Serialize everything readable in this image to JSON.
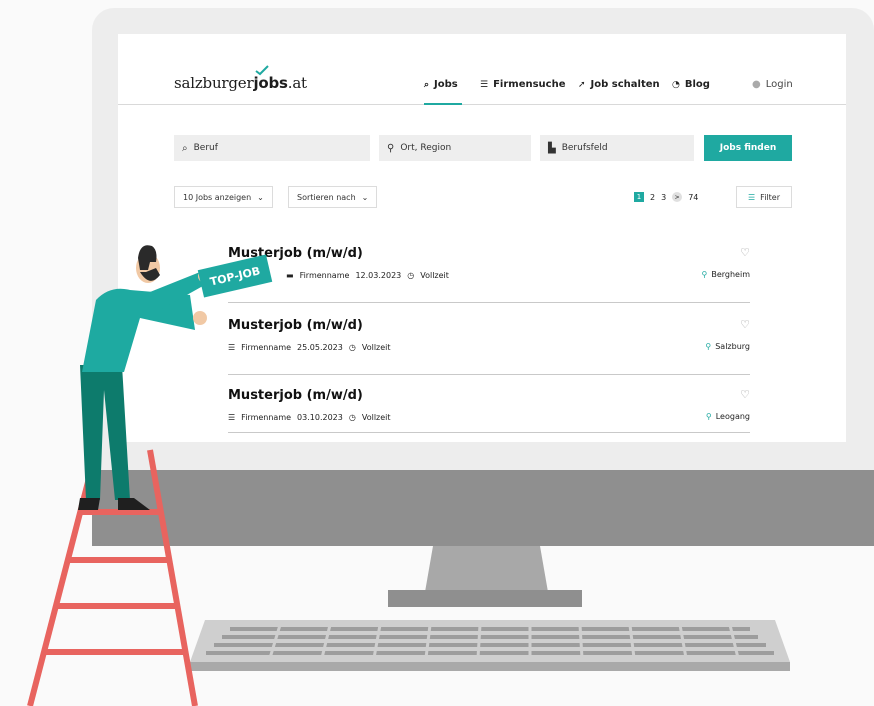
{
  "brand": {
    "name_part1": "salzburger",
    "name_part2": "jobs",
    "name_part3": ".at"
  },
  "nav": {
    "jobs": "Jobs",
    "firmensuche": "Firmensuche",
    "job_schalten": "Job schalten",
    "blog": "Blog",
    "login": "Login"
  },
  "search": {
    "beruf": "Beruf",
    "ort": "Ort, Region",
    "berufsfeld": "Berufsfeld",
    "button": "Jobs finden"
  },
  "controls": {
    "show": "10 Jobs anzeigen",
    "sort": "Sortieren nach",
    "filter": "Filter"
  },
  "pagination": {
    "current": "1",
    "p2": "2",
    "p3": "3",
    "next": ">",
    "last": "74"
  },
  "jobs": [
    {
      "title": "Musterjob (m/w/d)",
      "company": "Firmenname",
      "date": "12.03.2023",
      "type": "Vollzeit",
      "location": "Bergheim"
    },
    {
      "title": "Musterjob (m/w/d)",
      "company": "Firmenname",
      "date": "25.05.2023",
      "type": "Vollzeit",
      "location": "Salzburg"
    },
    {
      "title": "Musterjob (m/w/d)",
      "company": "Firmenname",
      "date": "03.10.2023",
      "type": "Vollzeit",
      "location": "Leogang"
    }
  ],
  "badge": "TOP-JOB",
  "colors": {
    "accent": "#1fa9a1",
    "monitor": "#8e8e8e",
    "ladder": "#e8645f"
  }
}
